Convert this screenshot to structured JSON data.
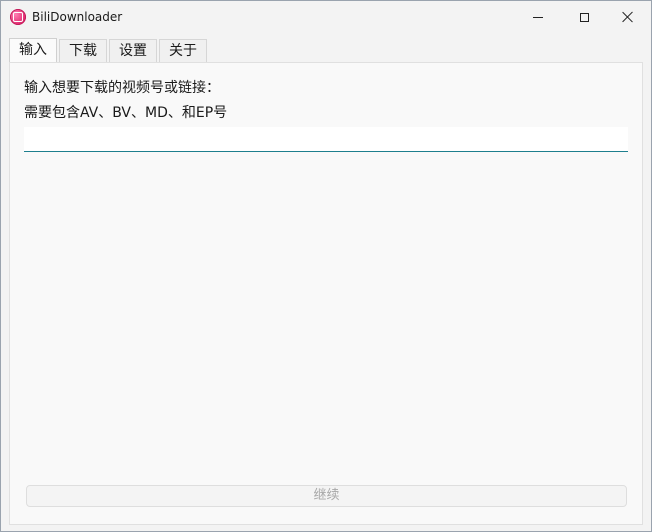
{
  "window": {
    "title": "BiliDownloader",
    "icon": "bili-app-icon"
  },
  "titlebar_controls": {
    "minimize": "minimize-icon",
    "maximize": "maximize-icon",
    "close": "close-icon"
  },
  "tabs": [
    {
      "label": "输入",
      "active": true
    },
    {
      "label": "下载",
      "active": false
    },
    {
      "label": "设置",
      "active": false
    },
    {
      "label": "关于",
      "active": false
    }
  ],
  "input_page": {
    "prompt_line1": "输入想要下载的视频号或链接：",
    "prompt_line2": "需要包含AV、BV、MD、和EP号",
    "input_value": "",
    "input_placeholder": "",
    "continue_label": "继续",
    "continue_enabled": false
  },
  "colors": {
    "input_underline": "#1e7f8e",
    "disabled_text": "#a8a8a8"
  }
}
